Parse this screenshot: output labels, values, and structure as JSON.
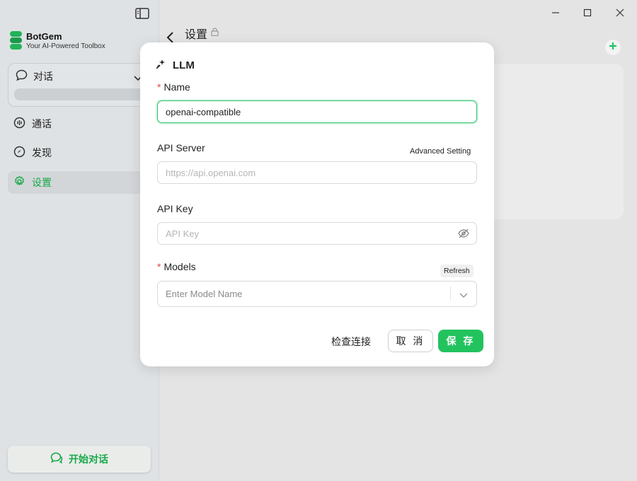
{
  "sidebar": {
    "brand_name": "BotGem",
    "brand_tagline": "Your AI-Powered Toolbox",
    "chat_section_label": "对话",
    "nav": [
      {
        "label": "通话",
        "icon": "voice-icon"
      },
      {
        "label": "发现",
        "icon": "compass-icon"
      },
      {
        "label": "设置",
        "icon": "gear-icon",
        "active": true
      }
    ],
    "start_button": "开始对话"
  },
  "header": {
    "title": "设置"
  },
  "modal": {
    "title": "LLM",
    "name_label": "Name",
    "name_value": "openai-compatible",
    "api_server_label": "API Server",
    "advanced_setting": "Advanced Setting",
    "api_server_placeholder": "https://api.openai.com",
    "api_key_label": "API Key",
    "api_key_placeholder": "API Key",
    "models_label": "Models",
    "refresh_label": "Refresh",
    "models_placeholder": "Enter Model Name",
    "check_button": "检查连接",
    "cancel_button": "取 消",
    "save_button": "保 存"
  },
  "colors": {
    "accent": "#22c35e",
    "required": "#e54646"
  }
}
